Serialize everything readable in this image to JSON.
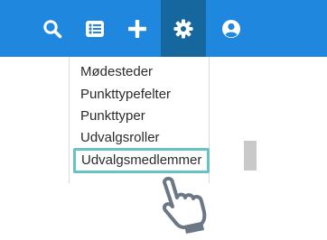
{
  "topbar": {
    "background": "#1f87dd",
    "active_background": "#17679f",
    "icons": [
      {
        "name": "search-icon"
      },
      {
        "name": "list-icon"
      },
      {
        "name": "plus-icon"
      },
      {
        "name": "gear-icon",
        "active": true
      },
      {
        "name": "user-circle-icon"
      }
    ]
  },
  "menu": {
    "items": [
      {
        "label": "Mødesteder"
      },
      {
        "label": "Punkttypefelter"
      },
      {
        "label": "Punkttyper"
      },
      {
        "label": "Udvalgsroller"
      },
      {
        "label": "Udvalgsmedlemmer",
        "highlighted": true
      }
    ],
    "highlight_color": "#67c2c6"
  },
  "cursor": {
    "icon": "pointing-hand-icon",
    "color": "#6b7785"
  }
}
